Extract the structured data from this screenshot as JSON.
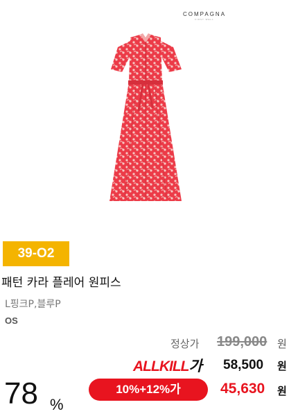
{
  "product": {
    "brand": "COMPAGNA",
    "brand_sub": "FIRST WELL",
    "image_icon": "dress-photo-icon",
    "code": "39-O2",
    "title": "패턴 카라 플레어 원피스",
    "colors": "L핑크P,블루P",
    "size": "OS"
  },
  "pricing": {
    "original_label": "정상가",
    "original_price": "199,000",
    "unit": "원",
    "allkill_prefix": "ALLKILL",
    "allkill_suffix": "가",
    "allkill_price": "58,500",
    "discount_rate": "78",
    "discount_unit": "%",
    "coupon_label": "10%+12%가",
    "final_price": "45,630"
  },
  "colors": {
    "accent_red": "#e8141f",
    "badge_yellow": "#f4b400",
    "dress_red": "#ec3b48"
  }
}
